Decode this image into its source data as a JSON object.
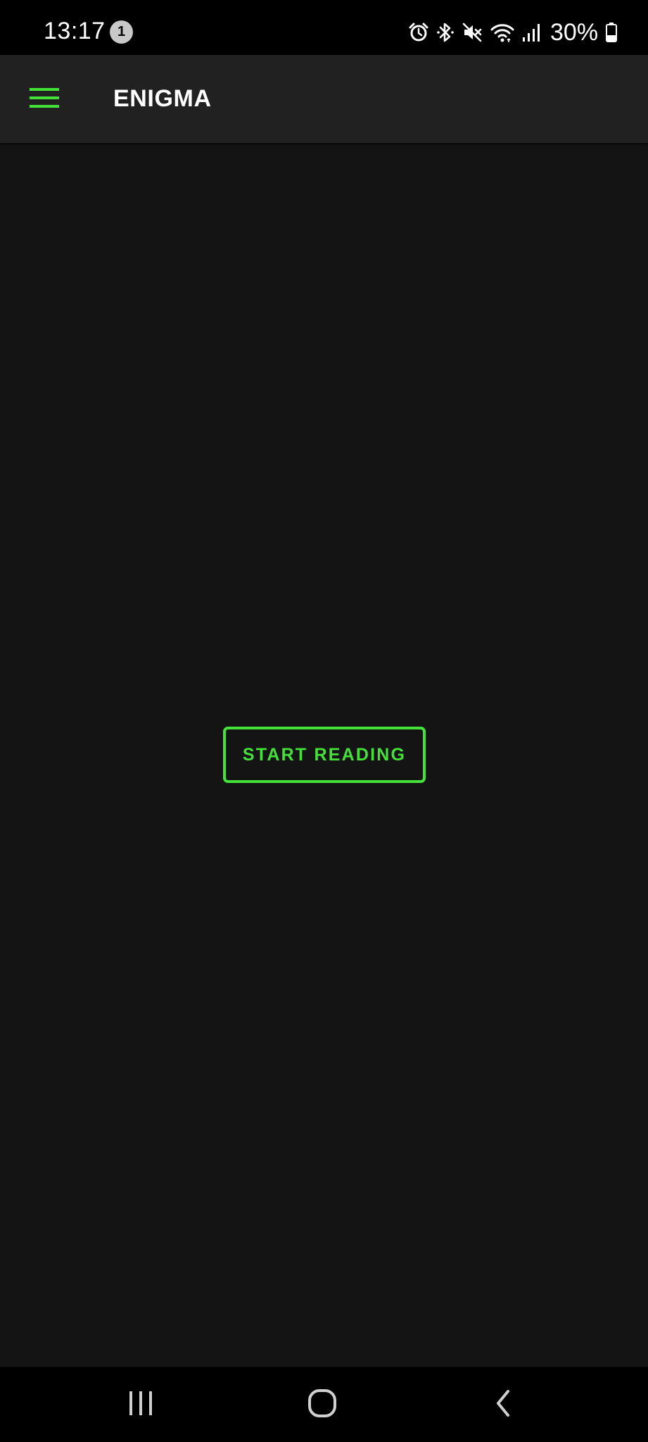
{
  "status_bar": {
    "time": "13:17",
    "notification_count": "1",
    "battery_percent": "30%",
    "icons": [
      "alarm-icon",
      "bluetooth-icon",
      "mute-icon",
      "wifi-icon",
      "signal-icon",
      "battery-icon"
    ]
  },
  "app_bar": {
    "title": "ENIGMA",
    "menu_icon": "hamburger-menu-icon"
  },
  "main": {
    "start_button_label": "START READING"
  },
  "nav_bar": {
    "icons": [
      "recent-apps-icon",
      "home-icon",
      "back-icon"
    ]
  },
  "colors": {
    "accent": "#44e139",
    "app_bar_bg": "#212121",
    "content_bg": "#141414",
    "status_bg": "#000000"
  }
}
